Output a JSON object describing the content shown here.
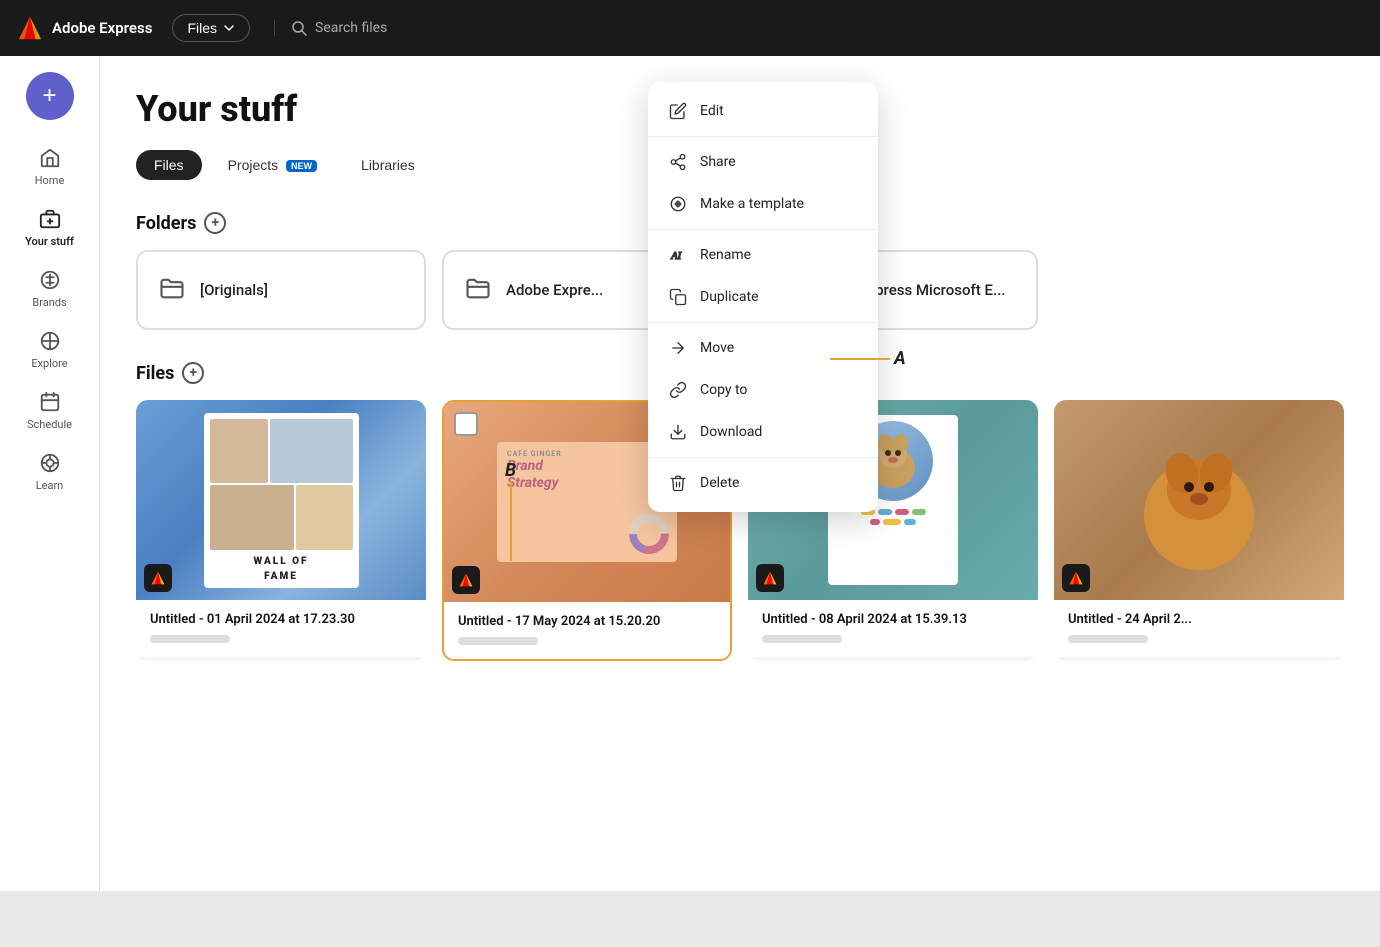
{
  "app": {
    "name": "Adobe Express",
    "nav_dropdown": "Files",
    "search_placeholder": "Search files"
  },
  "sidebar": {
    "add_button_label": "+",
    "items": [
      {
        "id": "home",
        "label": "Home",
        "icon": "home-icon"
      },
      {
        "id": "your-stuff",
        "label": "Your stuff",
        "icon": "box-icon",
        "active": true
      },
      {
        "id": "brands",
        "label": "Brands",
        "icon": "brands-icon"
      },
      {
        "id": "explore",
        "label": "Explore",
        "icon": "explore-icon"
      },
      {
        "id": "schedule",
        "label": "Schedule",
        "icon": "schedule-icon"
      },
      {
        "id": "learn",
        "label": "Learn",
        "icon": "learn-icon"
      }
    ]
  },
  "page": {
    "title": "Your stuff",
    "tabs": [
      {
        "id": "files",
        "label": "Files",
        "active": true
      },
      {
        "id": "projects",
        "label": "Projects",
        "badge": "NEW"
      },
      {
        "id": "libraries",
        "label": "Libraries"
      }
    ]
  },
  "folders": {
    "section_label": "Folders",
    "items": [
      {
        "name": "[Originals]"
      },
      {
        "name": "Adobe Expre..."
      },
      {
        "name": "Adobe Express Microsoft E..."
      }
    ]
  },
  "files": {
    "section_label": "Files",
    "items": [
      {
        "title": "Untitled - 01 April 2024 at 17.23.30"
      },
      {
        "title": "Untitled - 17 May 2024 at 15.20.20",
        "selected": true
      },
      {
        "title": "Untitled - 08 April 2024 at 15.39.13"
      },
      {
        "title": "Untitled - 24 April 2..."
      }
    ]
  },
  "context_menu": {
    "items": [
      {
        "id": "edit",
        "label": "Edit",
        "icon": "edit-icon"
      },
      {
        "id": "share",
        "label": "Share",
        "icon": "share-icon"
      },
      {
        "id": "make-template",
        "label": "Make a template",
        "icon": "template-icon"
      },
      {
        "id": "rename",
        "label": "Rename",
        "icon": "rename-icon"
      },
      {
        "id": "duplicate",
        "label": "Duplicate",
        "icon": "duplicate-icon"
      },
      {
        "id": "move",
        "label": "Move",
        "icon": "move-icon"
      },
      {
        "id": "copy-to",
        "label": "Copy to",
        "icon": "copy-icon"
      },
      {
        "id": "download",
        "label": "Download",
        "icon": "download-icon"
      },
      {
        "id": "delete",
        "label": "Delete",
        "icon": "delete-icon"
      }
    ],
    "dividers_after": [
      0,
      2,
      4,
      7
    ]
  },
  "annotations": {
    "a_label": "A",
    "b_label": "B"
  }
}
